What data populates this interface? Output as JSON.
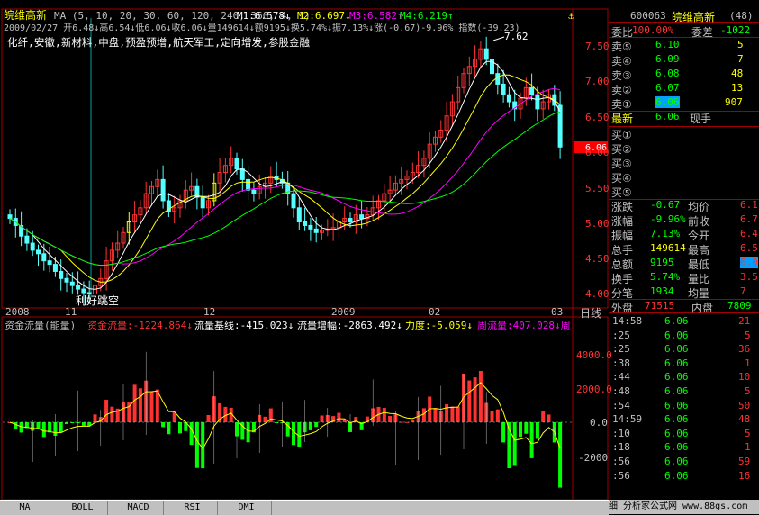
{
  "header": {
    "stock_name": "皖维高新",
    "ma_label": "MA (5, 10, 20, 30, 60, 120, 240, 360, 4, 1)",
    "m1": "M1:6.578↓",
    "m2": "M2:6.697↓",
    "m3": "M3:6.582↑",
    "m4": "M4:6.219↑",
    "ohlc": "2009/02/27  开6.48↓高6.54↓低6.06↓收6.06↓量149614↓额9195↓换5.74%↓振7.13%↓涨(-0.67)-9.96% 指数(-39.23)",
    "concepts": "化纤,安徽,新材料,中盘,预盈预增,航天军工,定向增发,参股金融",
    "peak_label": "7.62",
    "annotation": "利好跳空",
    "current_price_tag": "6.06",
    "colors": {
      "up": "#ff3232",
      "down": "#54ffff",
      "ma1": "#ffffff",
      "ma2": "#ffff00",
      "ma3": "#ff00ff",
      "ma4": "#00ff00"
    }
  },
  "y_axis": [
    "7.50",
    "7.00",
    "6.50",
    "6.00",
    "5.50",
    "5.00",
    "4.50",
    "4.00"
  ],
  "x_axis": [
    "2008",
    "11",
    "12",
    "2009",
    "02",
    "03"
  ],
  "x_unit": "日线",
  "indicator": {
    "title": "资金流量(能量)",
    "flow": "资金流量:-1224.864↓",
    "base": "流量基线:-415.023↓",
    "incr": "流量增幅:-2863.492↓",
    "force": "力度:-5.059↓",
    "week": "周流量:407.028↓周",
    "y_axis": [
      "4000.0",
      "2000.0",
      "0.0",
      "-2000"
    ]
  },
  "quote": {
    "code": "600063",
    "name": "皖维高新",
    "count": "(48)",
    "ratio_label": "委比",
    "ratio_value": "100.00%",
    "diff_label": "委差",
    "diff_value": "-1022",
    "asks": [
      {
        "label": "卖⑤",
        "price": "6.10",
        "vol": "5"
      },
      {
        "label": "卖④",
        "price": "6.09",
        "vol": "7"
      },
      {
        "label": "卖③",
        "price": "6.08",
        "vol": "48"
      },
      {
        "label": "卖②",
        "price": "6.07",
        "vol": "13"
      },
      {
        "label": "卖①",
        "price": "6.06",
        "vol": "907"
      }
    ],
    "last_label": "最新",
    "last_value": "6.06",
    "hand_label": "现手",
    "bids": [
      "买①",
      "买②",
      "买③",
      "买④",
      "买⑤"
    ],
    "stats": [
      {
        "l1": "涨跌",
        "v1": "-0.67",
        "l2": "均价",
        "v2": "6.1"
      },
      {
        "l1": "涨幅",
        "v1": "-9.96%",
        "l2": "前收",
        "v2": "6.7"
      },
      {
        "l1": "振幅",
        "v1": "7.13%",
        "l2": "今开",
        "v2": "6.4"
      },
      {
        "l1": "总手",
        "v1": "149614",
        "l2": "最高",
        "v2": "6.5"
      },
      {
        "l1": "总额",
        "v1": "9195",
        "l2": "最低",
        "v2": "6.0"
      },
      {
        "l1": "换手",
        "v1": "5.74%",
        "l2": "量比",
        "v2": "3.5"
      },
      {
        "l1": "分笔",
        "v1": "1934",
        "l2": "均量",
        "v2": "7"
      }
    ],
    "outer_label": "外盘",
    "outer_value": "71515",
    "inner_label": "内盘",
    "inner_value": "7809"
  },
  "ticks": [
    {
      "t": "14:58",
      "p": "6.06",
      "v": "21"
    },
    {
      "t": ":25",
      "p": "6.06",
      "v": "5"
    },
    {
      "t": ":25",
      "p": "6.06",
      "v": "36"
    },
    {
      "t": ":38",
      "p": "6.06",
      "v": "1"
    },
    {
      "t": ":44",
      "p": "6.06",
      "v": "10"
    },
    {
      "t": ":48",
      "p": "6.06",
      "v": "5"
    },
    {
      "t": ":54",
      "p": "6.06",
      "v": "50"
    },
    {
      "t": "14:59",
      "p": "6.06",
      "v": "48"
    },
    {
      "t": ":10",
      "p": "6.06",
      "v": "5"
    },
    {
      "t": ":18",
      "p": "6.06",
      "v": "1"
    },
    {
      "t": ":56",
      "p": "6.06",
      "v": "59"
    },
    {
      "t": ":56",
      "p": "6.06",
      "v": "16"
    }
  ],
  "tabs": [
    "MA",
    "BOLL",
    "MACD",
    "RSI",
    "DMI"
  ],
  "footer_text": "细  分析家公式网 www.88gs.com"
}
